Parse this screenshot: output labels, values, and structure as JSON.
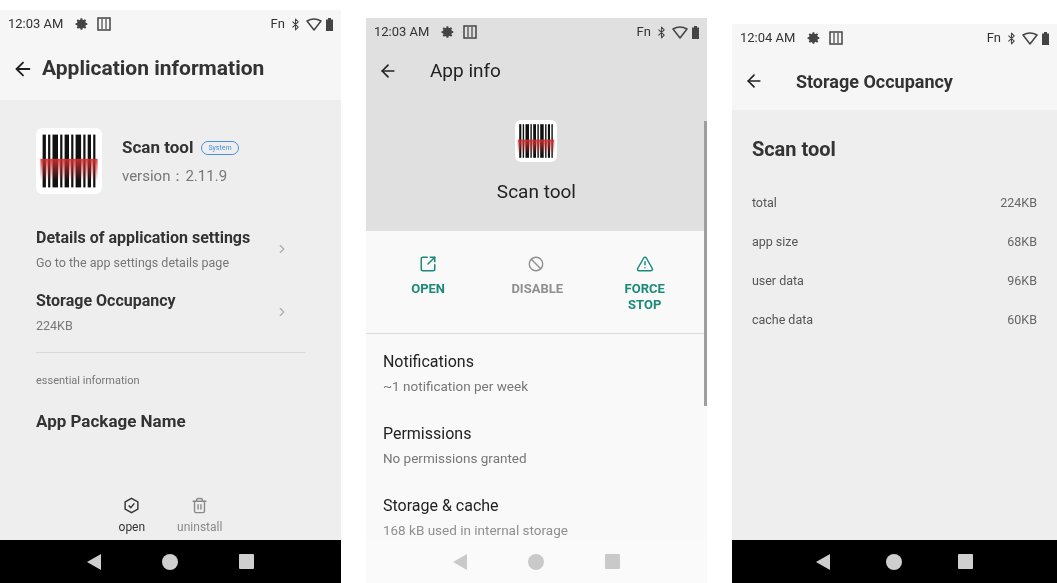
{
  "application_information": {
    "status_bar": {
      "time": "12:03 AM",
      "fn": "Fn"
    },
    "title": "Application information",
    "app": {
      "name": "Scan tool",
      "badge": "System",
      "version": "version：2.11.9"
    },
    "rows": [
      {
        "title": "Details of application settings",
        "subtitle": "Go to the app settings details page"
      },
      {
        "title": "Storage Occupancy",
        "subtitle": "224KB"
      }
    ],
    "section": "essential information",
    "package_label": "App Package Name",
    "actions": [
      {
        "kind": "open",
        "label": "open",
        "disabled": false
      },
      {
        "kind": "uninstall",
        "label": "uninstall",
        "disabled": true
      }
    ]
  },
  "app_info": {
    "status_bar": {
      "time": "12:03 AM",
      "fn": "Fn"
    },
    "title": "App info",
    "app_name": "Scan tool",
    "actions": [
      {
        "kind": "open",
        "label": "OPEN",
        "disabled": false
      },
      {
        "kind": "disable",
        "label": "DISABLE",
        "disabled": true
      },
      {
        "kind": "force_stop",
        "label": "FORCE STOP",
        "disabled": false
      }
    ],
    "items": [
      {
        "title": "Notifications",
        "subtitle": "~1 notification per week"
      },
      {
        "title": "Permissions",
        "subtitle": "No permissions granted"
      },
      {
        "title": "Storage & cache",
        "subtitle": "168 kB used in internal storage"
      }
    ]
  },
  "storage_occupancy": {
    "status_bar": {
      "time": "12:04 AM",
      "fn": "Fn"
    },
    "title": "Storage Occupancy",
    "app_name": "Scan tool",
    "rows": [
      {
        "label": "total",
        "value": "224KB"
      },
      {
        "label": "app size",
        "value": "68KB"
      },
      {
        "label": "user data",
        "value": "96KB"
      },
      {
        "label": "cache data",
        "value": "60KB"
      }
    ]
  }
}
